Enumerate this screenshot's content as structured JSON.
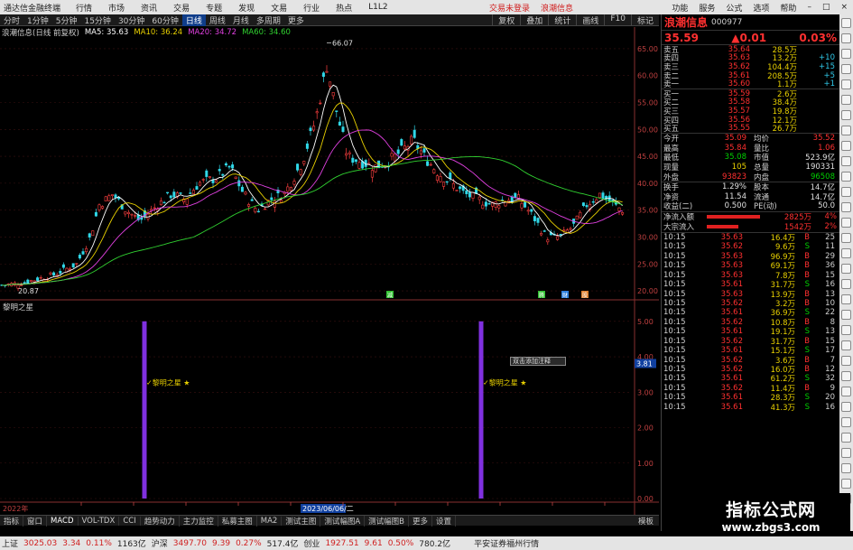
{
  "app": {
    "title": "通达信金融终端",
    "menu": [
      "行情",
      "市场",
      "资讯",
      "交易",
      "专题",
      "发现",
      "文易",
      "行业",
      "热点",
      "L1L2"
    ],
    "notices": [
      "交易未登录",
      "浪潮信息"
    ],
    "window_buttons": [
      "功能",
      "服务",
      "公式",
      "选项",
      "帮助"
    ]
  },
  "toolbar": {
    "periods": [
      "分时",
      "1分钟",
      "5分钟",
      "15分钟",
      "30分钟",
      "60分钟",
      "日线",
      "周线",
      "月线",
      "多周期",
      "更多"
    ],
    "active": "日线",
    "right_buttons": [
      "复权",
      "叠加",
      "统计",
      "画线",
      "F10",
      "标记"
    ]
  },
  "legend": {
    "name": "浪潮信息(日线 前复权)",
    "items": [
      {
        "label": "MA5: 35.63",
        "color": "#ffffff"
      },
      {
        "label": "MA10: 36.24",
        "color": "#e8d000"
      },
      {
        "label": "MA20: 34.72",
        "color": "#e040e0"
      },
      {
        "label": "MA60: 34.60",
        "color": "#30d030"
      }
    ]
  },
  "price_axis": {
    "ticks": [
      "65.00",
      "60.00",
      "55.00",
      "50.00",
      "45.00",
      "40.00",
      "35.00",
      "30.00",
      "25.00",
      "20.00"
    ],
    "high_label": "66.07",
    "low_label": "20.87"
  },
  "indicator": {
    "title": "黎明之星",
    "ticks": [
      "5.00",
      "4.00",
      "3.00",
      "2.00",
      "1.00",
      "0.00"
    ],
    "cursor_value": "3.81",
    "signal_label": "黎明之星",
    "popup_text": "双击添加注释",
    "cursor_date": "2023/06/06/二",
    "start_label": "2022年"
  },
  "event_markers": [
    "减",
    "腾",
    "财",
    "股"
  ],
  "tabs": {
    "items": [
      "指标",
      "窗口",
      "MACD",
      "VOL-TDX",
      "CCI",
      "趋势动力",
      "主力监控",
      "私募主图",
      "MA2",
      "测试主图",
      "测试幅图A",
      "测试幅图B",
      "更多",
      "设置"
    ],
    "right_label": "模板"
  },
  "quote": {
    "name": "浪潮信息",
    "code": "000977",
    "price": "35.59",
    "change": "▲0.01",
    "pct": "0.03%",
    "asks": [
      {
        "label": "卖五",
        "price": "35.64",
        "vol": "28.5万",
        "chg": ""
      },
      {
        "label": "卖四",
        "price": "35.63",
        "vol": "13.2万",
        "chg": "+10"
      },
      {
        "label": "卖三",
        "price": "35.62",
        "vol": "104.4万",
        "chg": "+15"
      },
      {
        "label": "卖二",
        "price": "35.61",
        "vol": "208.5万",
        "chg": "+5"
      },
      {
        "label": "卖一",
        "price": "35.60",
        "vol": "1.1万",
        "chg": "+1"
      }
    ],
    "bids": [
      {
        "label": "买一",
        "price": "35.59",
        "vol": "2.6万",
        "chg": ""
      },
      {
        "label": "买二",
        "price": "35.58",
        "vol": "38.4万",
        "chg": ""
      },
      {
        "label": "买三",
        "price": "35.57",
        "vol": "19.8万",
        "chg": ""
      },
      {
        "label": "买四",
        "price": "35.56",
        "vol": "12.1万",
        "chg": ""
      },
      {
        "label": "买五",
        "price": "35.55",
        "vol": "26.7万",
        "chg": ""
      }
    ],
    "stats": [
      {
        "k1": "今开",
        "v1": "35.09",
        "c1": "red",
        "k2": "均价",
        "v2": "35.52",
        "c2": "red"
      },
      {
        "k1": "最高",
        "v1": "35.84",
        "c1": "red",
        "k2": "量比",
        "v2": "1.06",
        "c2": "red"
      },
      {
        "k1": "最低",
        "v1": "35.08",
        "c1": "green",
        "k2": "市值",
        "v2": "523.9亿",
        "c2": "white"
      },
      {
        "k1": "现量",
        "v1": "105",
        "c1": "yellow",
        "k2": "总量",
        "v2": "190331",
        "c2": "white"
      },
      {
        "k1": "外盘",
        "v1": "93823",
        "c1": "red",
        "k2": "内盘",
        "v2": "96508",
        "c2": "green"
      }
    ],
    "stats2": [
      {
        "k1": "换手",
        "v1": "1.29%",
        "c1": "white",
        "k2": "股本",
        "v2": "14.7亿",
        "c2": "white"
      },
      {
        "k1": "净资",
        "v1": "11.54",
        "c1": "white",
        "k2": "流通",
        "v2": "14.7亿",
        "c2": "white"
      },
      {
        "k1": "收益(二)",
        "v1": "0.500",
        "c1": "white",
        "k2": "PE(动)",
        "v2": "50.0",
        "c2": "white"
      }
    ],
    "flows": [
      {
        "label": "净流入额",
        "value": "2825万",
        "pct": "4%",
        "fill": 0.75
      },
      {
        "label": "大宗流入",
        "value": "1542万",
        "pct": "2%",
        "fill": 0.45
      }
    ],
    "trades": [
      {
        "t": "10:15",
        "p": "35.63",
        "v": "16.4万",
        "bs": "B",
        "n": "25"
      },
      {
        "t": "10:15",
        "p": "35.62",
        "v": "9.6万",
        "bs": "S",
        "n": "11"
      },
      {
        "t": "10:15",
        "p": "35.63",
        "v": "96.9万",
        "bs": "B",
        "n": "29"
      },
      {
        "t": "10:15",
        "p": "35.63",
        "v": "69.1万",
        "bs": "B",
        "n": "36"
      },
      {
        "t": "10:15",
        "p": "35.63",
        "v": "7.8万",
        "bs": "B",
        "n": "15"
      },
      {
        "t": "10:15",
        "p": "35.61",
        "v": "31.7万",
        "bs": "S",
        "n": "16"
      },
      {
        "t": "10:15",
        "p": "35.63",
        "v": "13.9万",
        "bs": "B",
        "n": "13"
      },
      {
        "t": "10:15",
        "p": "35.62",
        "v": "3.2万",
        "bs": "B",
        "n": "10"
      },
      {
        "t": "10:15",
        "p": "35.61",
        "v": "36.9万",
        "bs": "S",
        "n": "22"
      },
      {
        "t": "10:15",
        "p": "35.62",
        "v": "10.8万",
        "bs": "B",
        "n": "8"
      },
      {
        "t": "10:15",
        "p": "35.61",
        "v": "19.1万",
        "bs": "S",
        "n": "13"
      },
      {
        "t": "10:15",
        "p": "35.62",
        "v": "31.7万",
        "bs": "B",
        "n": "15"
      },
      {
        "t": "10:15",
        "p": "35.61",
        "v": "15.1万",
        "bs": "S",
        "n": "17"
      },
      {
        "t": "10:15",
        "p": "35.62",
        "v": "3.6万",
        "bs": "B",
        "n": "7"
      },
      {
        "t": "10:15",
        "p": "35.62",
        "v": "16.0万",
        "bs": "B",
        "n": "12"
      },
      {
        "t": "10:15",
        "p": "35.61",
        "v": "61.2万",
        "bs": "S",
        "n": "32"
      },
      {
        "t": "10:15",
        "p": "35.62",
        "v": "11.4万",
        "bs": "B",
        "n": "9"
      },
      {
        "t": "10:15",
        "p": "35.61",
        "v": "28.3万",
        "bs": "S",
        "n": "20"
      },
      {
        "t": "10:15",
        "p": "35.61",
        "v": "41.3万",
        "bs": "S",
        "n": "16"
      }
    ]
  },
  "status": {
    "items": [
      {
        "name": "上证",
        "v": "3025.03",
        "c": "3.34",
        "p": "0.11%",
        "amt": "1163亿"
      },
      {
        "name": "沪深",
        "v": "3497.70",
        "c": "9.39",
        "p": "0.27%",
        "amt": "517.4亿"
      },
      {
        "name": "创业",
        "v": "1927.51",
        "c": "9.61",
        "p": "0.50%",
        "amt": "780.2亿"
      }
    ],
    "broker": "平安证券福州行情"
  },
  "watermark": {
    "line1": "指标公式网",
    "line2": "www.zbgs3.com"
  }
}
